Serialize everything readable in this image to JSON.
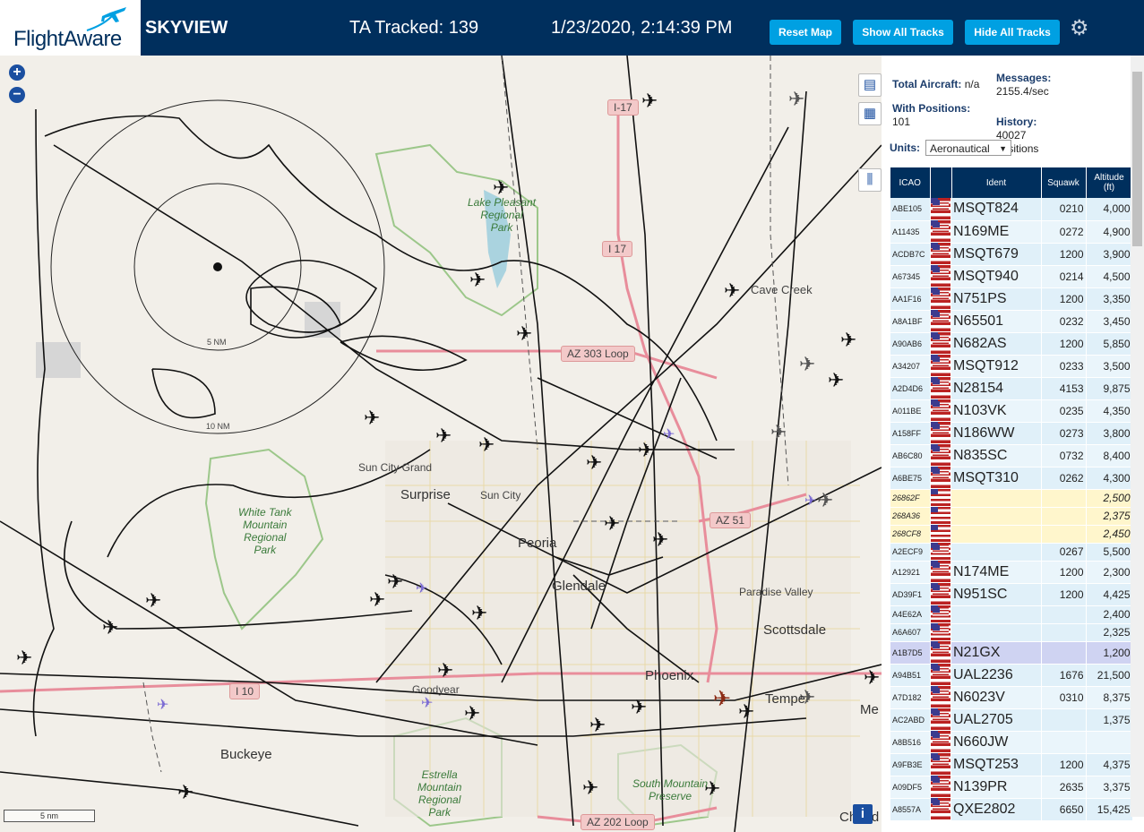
{
  "header": {
    "logo_text": "FlightAware",
    "app_name": "SKYVIEW",
    "tracked": "TA Tracked: 139",
    "datetime": "1/23/2020, 2:14:39 PM",
    "buttons": {
      "reset": "Reset Map",
      "show": "Show All Tracks",
      "hide": "Hide All Tracks"
    }
  },
  "map": {
    "zoom_in": "+",
    "zoom_out": "−",
    "range_5": "5 NM",
    "range_10": "10 NM",
    "scale": "5 nm",
    "labels": {
      "lake": "Lake Pleasant\nRegional\nPark",
      "cave_creek": "Cave Creek",
      "sun_city_grand": "Sun City Grand",
      "surprise": "Surprise",
      "sun_city": "Sun City",
      "white_tank": "White Tank\nMountain\nRegional\nPark",
      "peoria": "Peoria",
      "glendale": "Glendale",
      "paradise_valley": "Paradise Valley",
      "scottsdale": "Scottsdale",
      "phoenix": "Phoenix",
      "goodyear": "Goodyear",
      "tempe": "Tempe",
      "me": "Me",
      "buckeye": "Buckeye",
      "estrella": "Estrella\nMountain\nRegional\nPark",
      "south_mountain": "South Mountain\nPreserve",
      "chandler": "Chand"
    },
    "shields": {
      "i17a": "I-17",
      "i17b": "I 17",
      "az303": "AZ 303 Loop",
      "az51": "AZ 51",
      "i10": "I 10",
      "az202": "AZ 202 Loop"
    },
    "info": "i"
  },
  "sidebar": {
    "total_label": "Total Aircraft:",
    "total_value": "n/a",
    "positions_label": "With Positions:",
    "positions_value": "101",
    "messages_label": "Messages:",
    "messages_value": "2155.4/sec",
    "history_label": "History:",
    "history_value": "40027\npositions",
    "units_label": "Units:",
    "units_value": "Aeronautical",
    "columns": [
      "ICAO",
      "",
      "Ident",
      "Squawk",
      "Altitude\n(ft)"
    ],
    "rows": [
      {
        "icao": "ABE105",
        "ident": "MSQT824",
        "squawk": "0210",
        "alt": "4,000"
      },
      {
        "icao": "A11435",
        "ident": "N169ME",
        "squawk": "0272",
        "alt": "4,900"
      },
      {
        "icao": "ACDB7C",
        "ident": "MSQT679",
        "squawk": "1200",
        "alt": "3,900"
      },
      {
        "icao": "A67345",
        "ident": "MSQT940",
        "squawk": "0214",
        "alt": "4,500"
      },
      {
        "icao": "AA1F16",
        "ident": "N751PS",
        "squawk": "1200",
        "alt": "3,350"
      },
      {
        "icao": "A8A1BF",
        "ident": "N65501",
        "squawk": "0232",
        "alt": "3,450"
      },
      {
        "icao": "A90AB6",
        "ident": "N682AS",
        "squawk": "1200",
        "alt": "5,850"
      },
      {
        "icao": "A34207",
        "ident": "MSQT912",
        "squawk": "0233",
        "alt": "3,500"
      },
      {
        "icao": "A2D4D6",
        "ident": "N28154",
        "squawk": "4153",
        "alt": "9,875"
      },
      {
        "icao": "A011BE",
        "ident": "N103VK",
        "squawk": "0235",
        "alt": "4,350"
      },
      {
        "icao": "A158FF",
        "ident": "N186WW",
        "squawk": "0273",
        "alt": "3,800"
      },
      {
        "icao": "AB6C80",
        "ident": "N835SC",
        "squawk": "0732",
        "alt": "8,400"
      },
      {
        "icao": "A6BE75",
        "ident": "MSQT310",
        "squawk": "0262",
        "alt": "4,300"
      },
      {
        "icao": "26862F",
        "ident": "",
        "squawk": "",
        "alt": "2,500",
        "type": "noident"
      },
      {
        "icao": "268A36",
        "ident": "",
        "squawk": "",
        "alt": "2,375",
        "type": "noident"
      },
      {
        "icao": "268CF8",
        "ident": "",
        "squawk": "",
        "alt": "2,450",
        "type": "noident"
      },
      {
        "icao": "A2ECF9",
        "ident": "",
        "squawk": "0267",
        "alt": "5,500",
        "type": "short"
      },
      {
        "icao": "A12921",
        "ident": "N174ME",
        "squawk": "1200",
        "alt": "2,300"
      },
      {
        "icao": "AD39F1",
        "ident": "N951SC",
        "squawk": "1200",
        "alt": "4,425"
      },
      {
        "icao": "A4E62A",
        "ident": "",
        "squawk": "",
        "alt": "2,400",
        "type": "short"
      },
      {
        "icao": "A6A607",
        "ident": "",
        "squawk": "",
        "alt": "2,325",
        "type": "short"
      },
      {
        "icao": "A1B7D5",
        "ident": "N21GX",
        "squawk": "",
        "alt": "1,200",
        "type": "sel"
      },
      {
        "icao": "A94B51",
        "ident": "UAL2236",
        "squawk": "1676",
        "alt": "21,500"
      },
      {
        "icao": "A7D182",
        "ident": "N6023V",
        "squawk": "0310",
        "alt": "8,375"
      },
      {
        "icao": "AC2ABD",
        "ident": "UAL2705",
        "squawk": "",
        "alt": "1,375"
      },
      {
        "icao": "A8B516",
        "ident": "N660JW",
        "squawk": "",
        "alt": ""
      },
      {
        "icao": "A9FB3E",
        "ident": "MSQT253",
        "squawk": "1200",
        "alt": "4,375"
      },
      {
        "icao": "A09DF5",
        "ident": "N139PR",
        "squawk": "2635",
        "alt": "3,375"
      },
      {
        "icao": "A8557A",
        "ident": "QXE2802",
        "squawk": "6650",
        "alt": "15,425"
      }
    ]
  }
}
